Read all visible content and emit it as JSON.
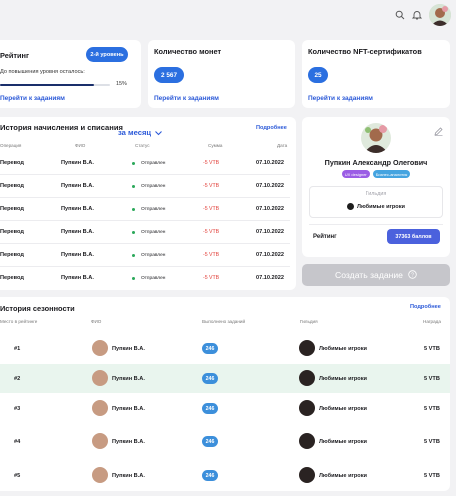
{
  "colors": {
    "accent": "#2b6fe0",
    "negative": "#e2413b",
    "status": "#2aa85a",
    "highlight": "#e9f5ee"
  },
  "rating": {
    "title": "Рейтинг",
    "level_button": "2-й уровень",
    "progress_label": "До повышения уровня осталось:",
    "progress_value": "15%",
    "progress_fraction": 0.85,
    "link": "Перейти к заданиям"
  },
  "coins": {
    "title": "Количество монет",
    "value": "2 567",
    "link": "Перейти к заданиям"
  },
  "nft": {
    "title": "Количество NFT-сертификатов",
    "value": "25",
    "link": "Перейти к заданиям"
  },
  "history": {
    "title": "История начисления и списания",
    "period": "за месяц",
    "more": "Подробнее",
    "columns": [
      "Операция",
      "ФИО",
      "Статус",
      "Сумма",
      "Дата"
    ],
    "rows": [
      {
        "op": "Перевод",
        "name": "Пупкин В.А.",
        "status": "Отправлен",
        "sum": "-5 VTB",
        "date": "07.10.2022"
      },
      {
        "op": "Перевод",
        "name": "Пупкин В.А.",
        "status": "Отправлен",
        "sum": "-5 VTB",
        "date": "07.10.2022"
      },
      {
        "op": "Перевод",
        "name": "Пупкин В.А.",
        "status": "Отправлен",
        "sum": "-5 VTB",
        "date": "07.10.2022"
      },
      {
        "op": "Перевод",
        "name": "Пупкин В.А.",
        "status": "Отправлен",
        "sum": "-5 VTB",
        "date": "07.10.2022"
      },
      {
        "op": "Перевод",
        "name": "Пупкин В.А.",
        "status": "Отправлен",
        "sum": "-5 VTB",
        "date": "07.10.2022"
      },
      {
        "op": "Перевод",
        "name": "Пупкин В.А.",
        "status": "Отправлен",
        "sum": "-5 VTB",
        "date": "07.10.2022"
      }
    ]
  },
  "profile": {
    "name": "Пупкин Александр Олегович",
    "tags": [
      "UX designer",
      "Бизнес-аналитик"
    ],
    "guild_label": "Гильдия",
    "guild_name": "Любимые игроки",
    "rating_label": "Рейтинг",
    "rating_value": "37363 баллов"
  },
  "create_task": {
    "label": "Создать задание",
    "icon": "question-circle-icon"
  },
  "seasons": {
    "title": "История сезонности",
    "more": "Подробнее",
    "columns": [
      "Место в рейтинге",
      "ФИО",
      "Выполнено заданий",
      "Гильдия",
      "Награда"
    ],
    "rows": [
      {
        "place": "#1",
        "name": "Пупкин В.А.",
        "tasks": "246",
        "guild": "Любимые игроки",
        "reward": "5 VTB"
      },
      {
        "place": "#2",
        "name": "Пупкин В.А.",
        "tasks": "246",
        "guild": "Любимые игроки",
        "reward": "5 VTB"
      },
      {
        "place": "#3",
        "name": "Пупкин В.А.",
        "tasks": "246",
        "guild": "Любимые игроки",
        "reward": "5 VTB"
      },
      {
        "place": "#4",
        "name": "Пупкин В.А.",
        "tasks": "246",
        "guild": "Любимые игроки",
        "reward": "5 VTB"
      },
      {
        "place": "#5",
        "name": "Пупкин В.А.",
        "tasks": "246",
        "guild": "Любимые игроки",
        "reward": "5 VTB"
      }
    ]
  }
}
